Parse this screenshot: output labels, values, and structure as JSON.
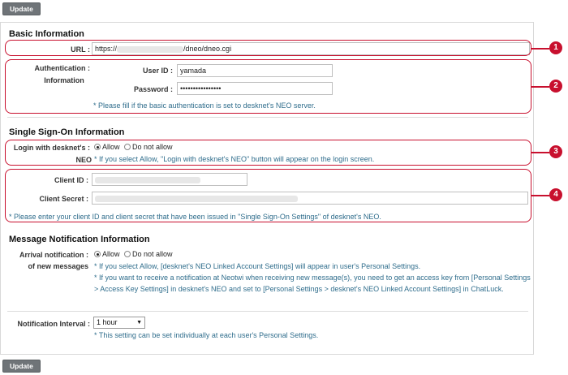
{
  "buttons": {
    "update_top": "Update",
    "update_bottom": "Update"
  },
  "basic": {
    "title": "Basic Information",
    "url_label": "URL :",
    "url_prefix": "https://",
    "url_suffix": "/dneo/dneo.cgi",
    "auth_label_1": "Authentication :",
    "auth_label_2": "Information",
    "userid_label": "User ID :",
    "userid_value": "yamada",
    "password_label": "Password :",
    "password_value": "••••••••••••••••",
    "auth_note": "* Please fill if the basic authentication is set to desknet's NEO server."
  },
  "sso": {
    "title": "Single Sign-On Information",
    "login_label_1": "Login with desknet's :",
    "login_label_2": "NEO",
    "allow": "Allow",
    "deny": "Do not allow",
    "login_note": "* If you select Allow, \"Login with desknet's NEO\" button will appear on the login screen.",
    "client_id_label": "Client ID :",
    "client_secret_label": "Client Secret :",
    "client_note": "* Please enter your client ID and client secret that have been issued in \"Single Sign-On Settings\" of desknet's NEO."
  },
  "message": {
    "title": "Message Notification Information",
    "arrival_label_1": "Arrival notification :",
    "arrival_label_2": "of new messages",
    "allow": "Allow",
    "deny": "Do not allow",
    "note_1": "* If you select Allow, [desknet's NEO Linked Account Settings] will appear in user's Personal Settings.",
    "note_2": "* If you want to receive a notification at Neotwi when receiving new message(s), you need to get an access key from [Personal Settings > Access Key Settings] in desknet's NEO and set to [Personal Settings > desknet's NEO Linked Account Settings] in ChatLuck.",
    "interval_label": "Notification Interval :",
    "interval_value": "1 hour",
    "interval_note": "* This setting can be set individually at each user's Personal Settings."
  },
  "callouts": [
    "1",
    "2",
    "3",
    "4"
  ],
  "colors": {
    "callout": "#c8102e",
    "note": "#2f6d8c",
    "button": "#6f7478"
  }
}
